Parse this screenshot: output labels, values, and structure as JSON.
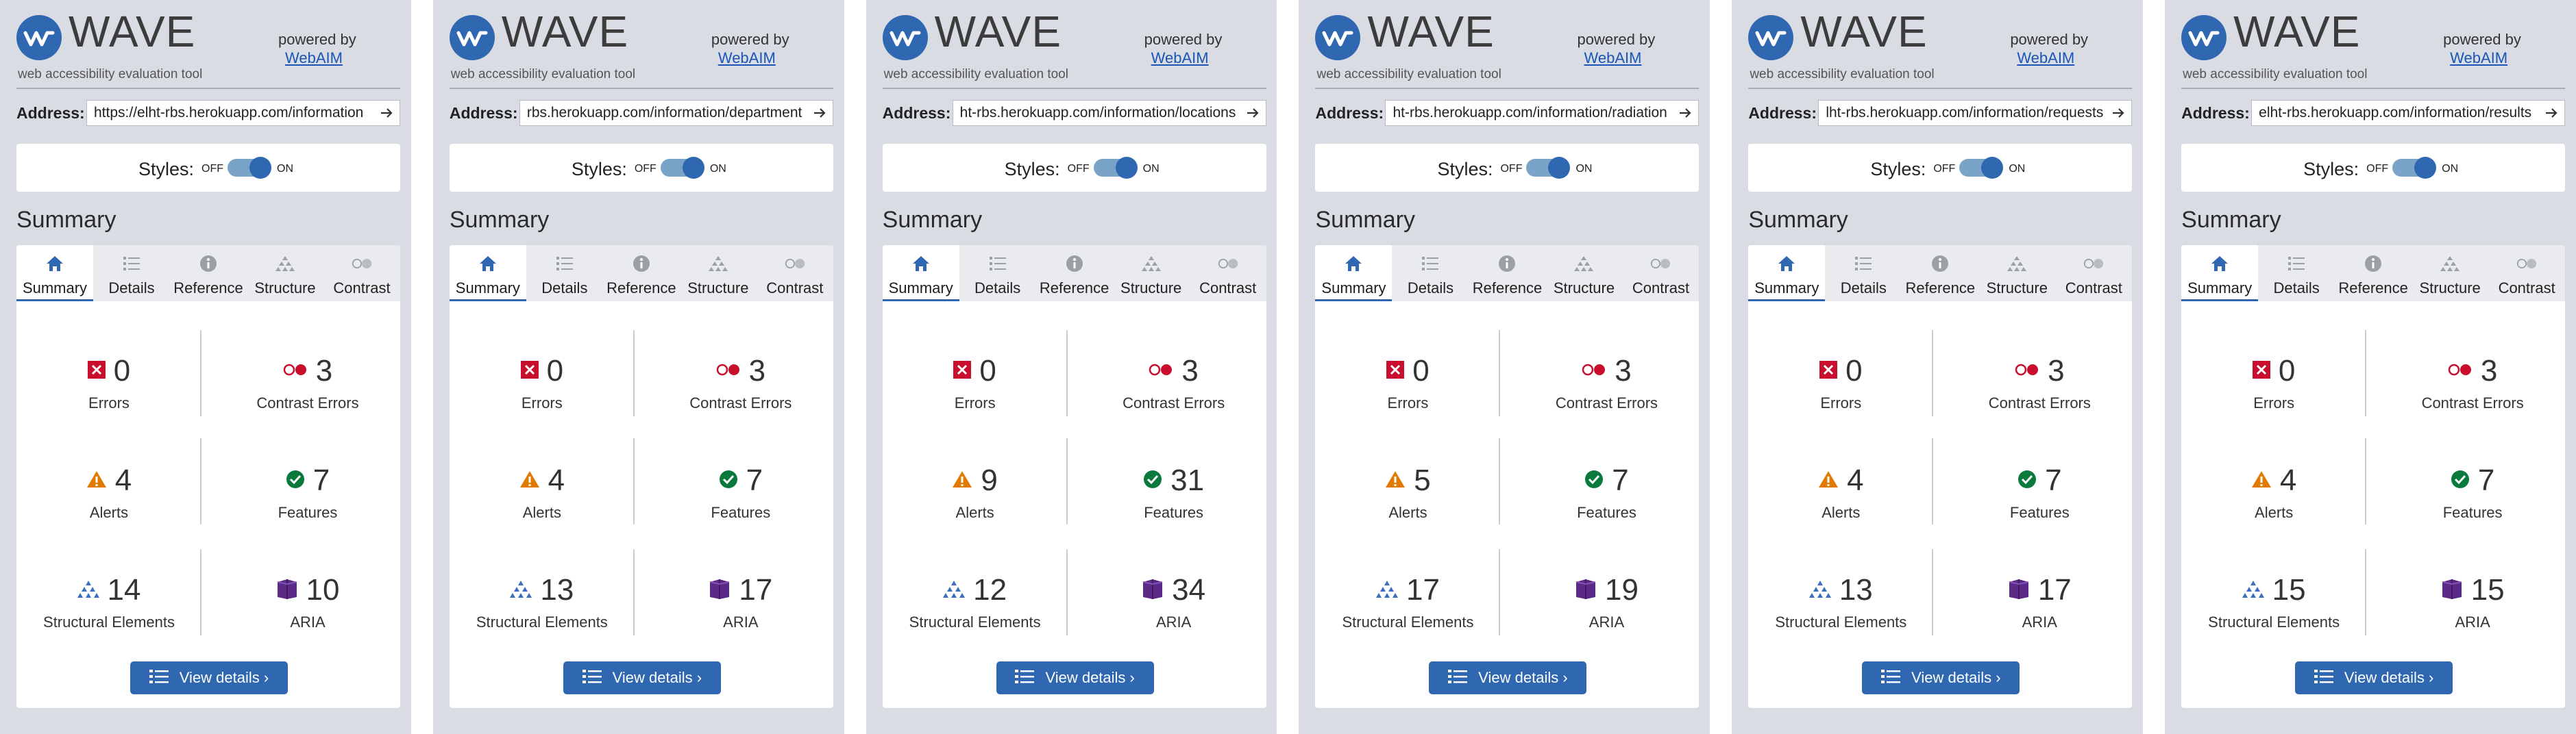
{
  "common": {
    "logo_text": "WAVE",
    "tagline": "web accessibility evaluation tool",
    "powered_by": "powered by",
    "webaim_link": "WebAIM",
    "address_label": "Address:",
    "styles_label": "Styles:",
    "toggle_off": "OFF",
    "toggle_on": "ON",
    "summary_title": "Summary",
    "tabs": [
      "Summary",
      "Details",
      "Reference",
      "Structure",
      "Contrast"
    ],
    "labels": {
      "errors": "Errors",
      "contrast_errors": "Contrast Errors",
      "alerts": "Alerts",
      "features": "Features",
      "structural": "Structural Elements",
      "aria": "ARIA"
    },
    "view_details": "View details ›",
    "colors": {
      "accent": "#2f68b1",
      "error": "#c8102e",
      "alert": "#e07b00",
      "feature": "#0a7a3c",
      "aria": "#5b2a86"
    }
  },
  "panels": [
    {
      "address": "https://elht-rbs.herokuapp.com/information",
      "errors": "0",
      "contrast_errors": "3",
      "alerts": "4",
      "features": "7",
      "structural": "14",
      "aria": "10"
    },
    {
      "address": "rbs.herokuapp.com/information/department",
      "errors": "0",
      "contrast_errors": "3",
      "alerts": "4",
      "features": "7",
      "structural": "13",
      "aria": "17"
    },
    {
      "address": "ht-rbs.herokuapp.com/information/locations",
      "errors": "0",
      "contrast_errors": "3",
      "alerts": "9",
      "features": "31",
      "structural": "12",
      "aria": "34"
    },
    {
      "address": "ht-rbs.herokuapp.com/information/radiation",
      "errors": "0",
      "contrast_errors": "3",
      "alerts": "5",
      "features": "7",
      "structural": "17",
      "aria": "19"
    },
    {
      "address": "lht-rbs.herokuapp.com/information/requests",
      "errors": "0",
      "contrast_errors": "3",
      "alerts": "4",
      "features": "7",
      "structural": "13",
      "aria": "17"
    },
    {
      "address": "elht-rbs.herokuapp.com/information/results",
      "errors": "0",
      "contrast_errors": "3",
      "alerts": "4",
      "features": "7",
      "structural": "15",
      "aria": "15"
    }
  ]
}
